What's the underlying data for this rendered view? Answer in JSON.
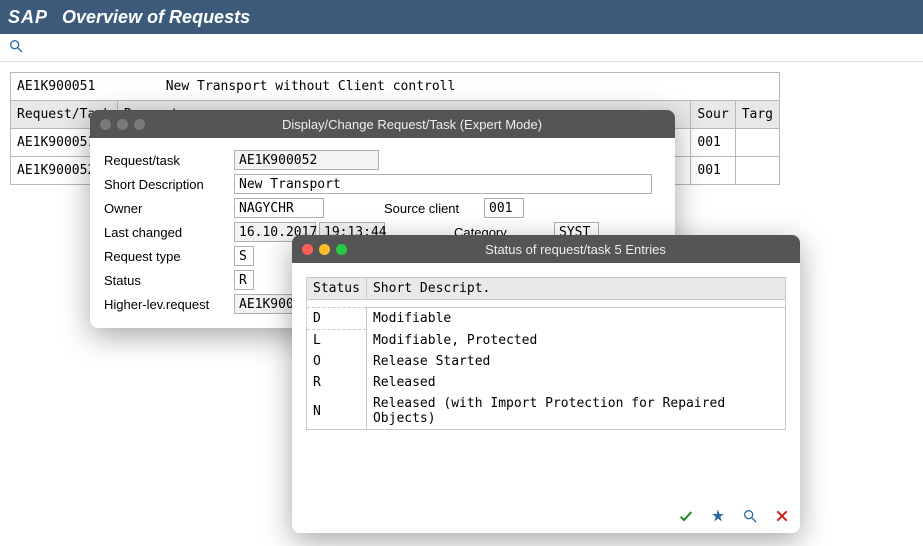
{
  "header": {
    "logo": "SAP",
    "title": "Overview of Requests"
  },
  "overview": {
    "info_request": "AE1K900051",
    "info_desc": "New Transport without Client controll",
    "columns": {
      "request_task": "Request/Task",
      "request": "Request",
      "source": "Sour",
      "target": "Targ"
    },
    "rows": [
      {
        "id": "AE1K900051",
        "source": "001",
        "target": ""
      },
      {
        "id": "AE1K900052",
        "source": "001",
        "target": ""
      }
    ]
  },
  "dialog_edit": {
    "title": "Display/Change Request/Task (Expert Mode)",
    "labels": {
      "request_task": "Request/task",
      "short_desc": "Short Description",
      "owner": "Owner",
      "last_changed": "Last changed",
      "request_type": "Request type",
      "status": "Status",
      "higher_level": "Higher-lev.request",
      "source_client": "Source client",
      "category": "Category"
    },
    "values": {
      "request_task": "AE1K900052",
      "short_desc": "New Transport",
      "owner": "NAGYCHR",
      "date": "16.10.2017",
      "time": "19:13:44",
      "request_type": "S",
      "status": "R",
      "higher_level": "AE1K90005",
      "source_client": "001",
      "category": "SYST"
    }
  },
  "dialog_status": {
    "title": "Status of request/task 5 Entries",
    "columns": {
      "status": "Status",
      "short": "Short Descript."
    },
    "rows": [
      {
        "code": "D",
        "desc": "Modifiable"
      },
      {
        "code": "L",
        "desc": "Modifiable, Protected"
      },
      {
        "code": "O",
        "desc": "Release Started"
      },
      {
        "code": "R",
        "desc": "Released"
      },
      {
        "code": "N",
        "desc": "Released (with Import Protection for Repaired Objects)"
      }
    ]
  }
}
